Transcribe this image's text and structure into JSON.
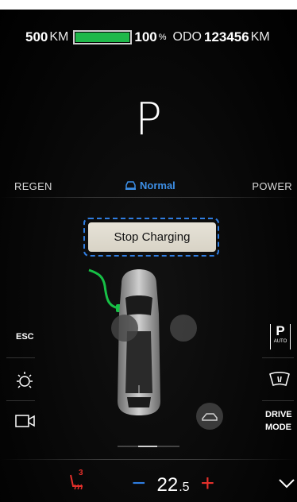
{
  "status": {
    "range_value": "500",
    "range_unit": "KM",
    "battery_percent": 100,
    "battery_label": "100",
    "percent_sign": "%",
    "odo_label": "ODO",
    "odo_value": "123456",
    "odo_unit": "KM"
  },
  "gear": "P",
  "drive_modes": {
    "left": "REGEN",
    "center": "Normal",
    "right": "POWER"
  },
  "charging": {
    "button_label": "Stop Charging"
  },
  "left_controls": {
    "esc_label": "ESC"
  },
  "right_controls": {
    "auto_label": "AUTO",
    "drive_mode_line1": "DRIVE",
    "drive_mode_line2": "MODE"
  },
  "climate": {
    "seat_heat_level": "3",
    "temp_whole": "22",
    "temp_decimal": ".5"
  },
  "colors": {
    "accent_blue": "#2f7de1",
    "battery_green": "#1fb84a",
    "heat_red": "#e5302b",
    "button_bg": "#e2ddd1"
  },
  "icons": [
    "car-mode-icon",
    "charging-cable-icon",
    "light-icon",
    "camera-icon",
    "auto-park-icon",
    "defrost-icon",
    "seat-heat-icon",
    "chevron-down-icon",
    "trunk-icon"
  ]
}
